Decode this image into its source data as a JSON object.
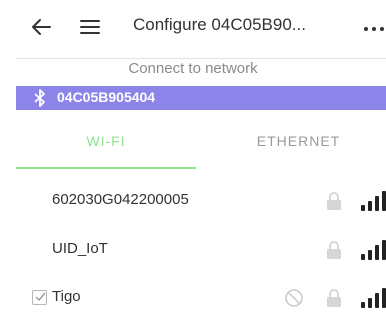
{
  "header": {
    "title": "Configure 04C05B90...",
    "subtitle": "Connect to network"
  },
  "device": {
    "name": "04C05B905404"
  },
  "tabs": [
    {
      "label": "WI-FI",
      "selected": true
    },
    {
      "label": "ETHERNET",
      "selected": false
    }
  ],
  "networks": [
    {
      "name": "602030G042200005",
      "secured": true,
      "signal": "full",
      "selected": false
    },
    {
      "name": "UID_IoT",
      "secured": true,
      "signal": "full",
      "selected": false
    },
    {
      "name": "Tigo",
      "secured": true,
      "signal": "full",
      "selected": true,
      "blocked_icon": true
    }
  ],
  "colors": {
    "accent": "#8c84e8",
    "tab_active": "#8ee48c"
  }
}
